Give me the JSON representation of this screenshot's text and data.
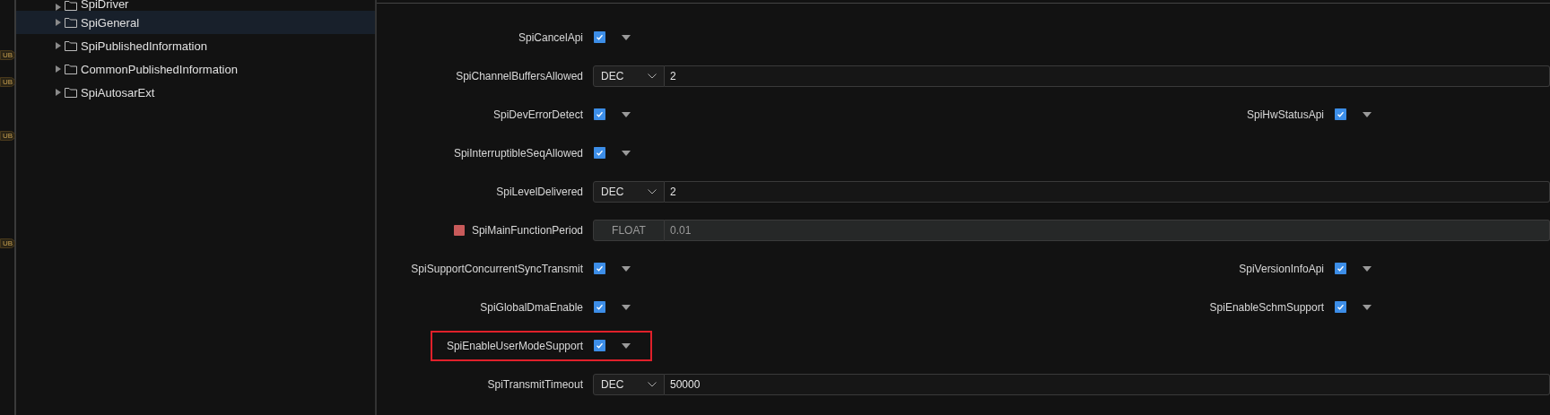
{
  "badges": [
    {
      "label": "UB"
    },
    {
      "label": "UB"
    },
    {
      "label": "UB"
    },
    {
      "label": "UB"
    }
  ],
  "tree": {
    "items": [
      {
        "label": "SpiDriver",
        "selected": false
      },
      {
        "label": "SpiGeneral",
        "selected": true
      },
      {
        "label": "SpiPublishedInformation",
        "selected": false
      },
      {
        "label": "CommonPublishedInformation",
        "selected": false
      },
      {
        "label": "SpiAutosarExt",
        "selected": false
      }
    ]
  },
  "params": [
    {
      "left": {
        "label": "SpiCancelApi",
        "kind": "checkbox",
        "checked": true
      }
    },
    {
      "left": {
        "label": "SpiChannelBuffersAllowed",
        "kind": "number",
        "format": "DEC",
        "value": "2"
      }
    },
    {
      "left": {
        "label": "SpiDevErrorDetect",
        "kind": "checkbox",
        "checked": true
      },
      "right": {
        "label": "SpiHwStatusApi",
        "kind": "checkbox",
        "checked": true
      }
    },
    {
      "left": {
        "label": "SpiInterruptibleSeqAllowed",
        "kind": "checkbox",
        "checked": true
      }
    },
    {
      "left": {
        "label": "SpiLevelDelivered",
        "kind": "number",
        "format": "DEC",
        "value": "2"
      }
    },
    {
      "left": {
        "label": "SpiMainFunctionPeriod",
        "kind": "number",
        "format": "FLOAT",
        "value": "0.01",
        "disabled": true,
        "error": true
      }
    },
    {
      "left": {
        "label": "SpiSupportConcurrentSyncTransmit",
        "kind": "checkbox",
        "checked": true
      },
      "right": {
        "label": "SpiVersionInfoApi",
        "kind": "checkbox",
        "checked": true
      }
    },
    {
      "left": {
        "label": "SpiGlobalDmaEnable",
        "kind": "checkbox",
        "checked": true
      },
      "right": {
        "label": "SpiEnableSchmSupport",
        "kind": "checkbox",
        "checked": true
      }
    },
    {
      "left": {
        "label": "SpiEnableUserModeSupport",
        "kind": "checkbox",
        "checked": true,
        "highlighted": true
      }
    },
    {
      "left": {
        "label": "SpiTransmitTimeout",
        "kind": "number",
        "format": "DEC",
        "value": "50000"
      }
    }
  ]
}
